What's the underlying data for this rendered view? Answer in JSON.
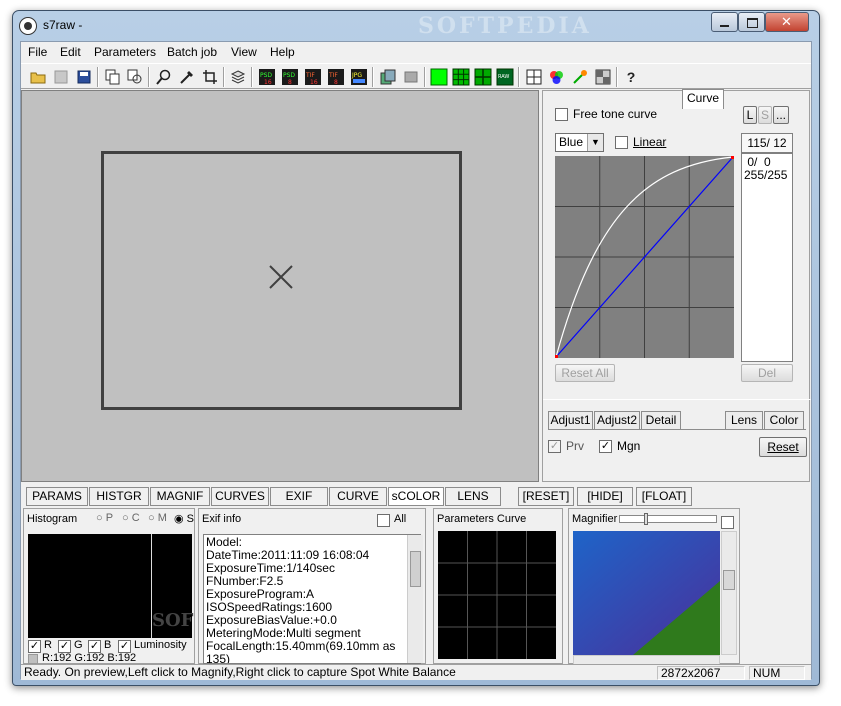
{
  "window": {
    "title": "s7raw -",
    "watermark": "SOFTPEDIA"
  },
  "menu": {
    "items": [
      "File",
      "Edit",
      "Parameters",
      "Batch job",
      "View",
      "Help"
    ]
  },
  "toolbar": {
    "icons": [
      "open-icon",
      "save-disabled-icon",
      "save-icon",
      "copy-icon",
      "copy-exif-icon",
      "zoom-icon",
      "eyedropper-icon",
      "crop-icon",
      "layers-icon",
      "save-psd-16-icon",
      "save-psd-icon",
      "save-tiff-16-icon",
      "save-tiff-icon",
      "save-jpeg-icon",
      "export-icon",
      "print-icon",
      "view-green-icon",
      "grid-9-icon",
      "grid-4-icon",
      "raw-view-icon",
      "grid-icon",
      "rgb-icon",
      "color-picker-icon",
      "compare-icon",
      "help-icon"
    ]
  },
  "curve_panel": {
    "free_tone_label": "Free tone curve",
    "lsave_buttons": [
      "L",
      "S",
      "..."
    ],
    "channel": "Blue",
    "linear_label": "Linear",
    "points_readout": "115/ 12",
    "points": [
      " 0/  0",
      "255/255"
    ],
    "reset_all": "Reset All",
    "del": "Del",
    "tabs": [
      "Adjust1",
      "Adjust2",
      "Detail",
      "Curve",
      "Lens",
      "Color"
    ],
    "active_tab": "Curve",
    "prv_label": "Prv",
    "mgn_label": "Mgn",
    "reset": "Reset",
    "colors": {
      "grid_bg": "#808080",
      "curve": "#ffffff",
      "linear": "#0000ff",
      "point": "#ff0000"
    }
  },
  "bottom_tabs": {
    "items": [
      "PARAMS",
      "HISTGR",
      "MAGNIF",
      "CURVES",
      "EXIF",
      "CURVE",
      "sCOLOR",
      "LENS",
      "[RESET]",
      "[HIDE]",
      "[FLOAT]"
    ],
    "active": "sCOLOR"
  },
  "histogram": {
    "title": "Histogram",
    "options": [
      "P",
      "C",
      "M",
      "S"
    ],
    "selected": "S",
    "channels": [
      "R",
      "G",
      "B",
      "Luminosity"
    ],
    "readout": "R:192 G:192 B:192",
    "watermark": "SOF"
  },
  "exif": {
    "title": "Exif info",
    "all_label": "All",
    "lines": [
      "Model:",
      "DateTime:2011:11:09 16:08:04",
      "ExposureTime:1/140sec",
      "FNumber:F2.5",
      "ExposureProgram:A",
      "ISOSpeedRatings:1600",
      "ExposureBiasValue:+0.0",
      "MeteringMode:Multi segment",
      "FocalLength:15.40mm(69.10mm as 135)"
    ]
  },
  "parameters_curve": {
    "title": "Parameters Curve"
  },
  "magnifier": {
    "title": "Magnifier"
  },
  "status": {
    "message": "Ready. On preview,Left click to Magnify,Right click to capture Spot White Balance",
    "dimensions": "2872x2067",
    "num": "NUM"
  }
}
